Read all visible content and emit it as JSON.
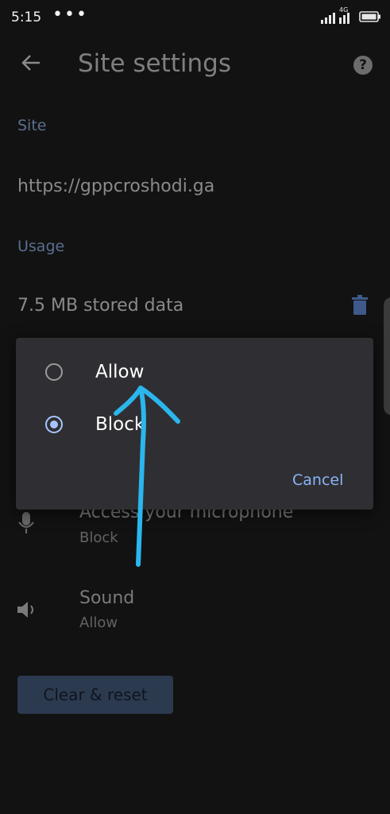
{
  "status_bar": {
    "time": "5:15",
    "network": "4G"
  },
  "header": {
    "title": "Site settings"
  },
  "sections": {
    "site_label": "Site",
    "site_url": "https://gppcroshodi.ga",
    "usage_label": "Usage",
    "stored_data": "7.5 MB stored data"
  },
  "permissions": [
    {
      "title": "Access your microphone",
      "value": "Block",
      "icon": "microphone-icon"
    },
    {
      "title": "Sound",
      "value": "Allow",
      "icon": "speaker-icon"
    }
  ],
  "clear_button": "Clear & reset",
  "dialog": {
    "options": [
      {
        "label": "Allow",
        "selected": false
      },
      {
        "label": "Block",
        "selected": true
      }
    ],
    "cancel_label": "Cancel"
  },
  "colors": {
    "accent": "#8ab4f8",
    "annotation": "#2bb6ee"
  }
}
